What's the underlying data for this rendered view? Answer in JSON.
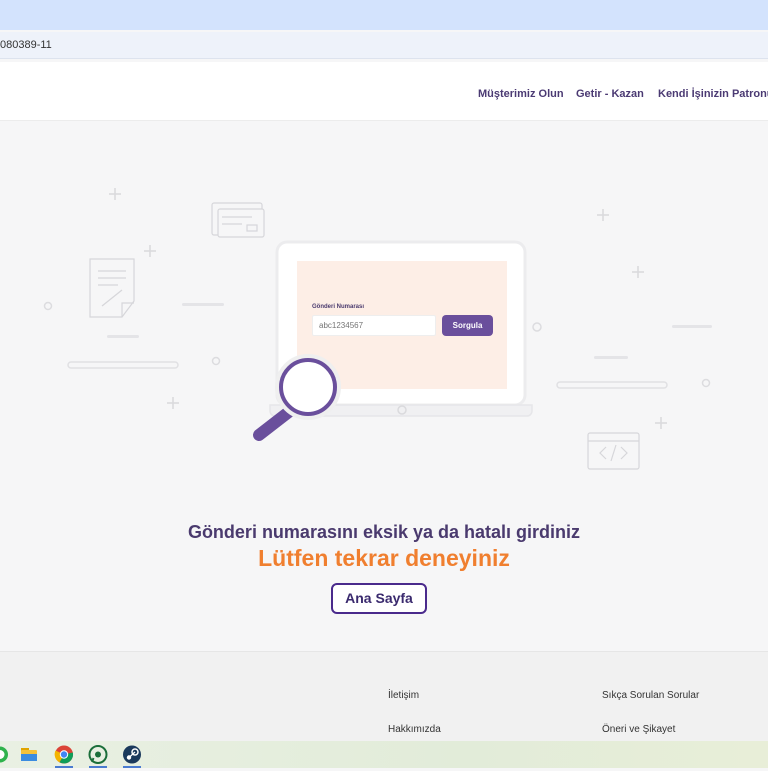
{
  "browser": {
    "url": "080389-11"
  },
  "nav": {
    "items": [
      {
        "label": "Müşterimiz Olun"
      },
      {
        "label": "Getir - Kazan"
      },
      {
        "label": "Kendi İşinizin Patronu O"
      }
    ]
  },
  "tracking": {
    "field_label": "Gönderi Numarası",
    "placeholder": "abc1234567",
    "button_label": "Sorgula"
  },
  "message": {
    "error": "Gönderi numarasını eksik ya da hatalı girdiniz",
    "retry": "Lütfen tekrar deneyiniz",
    "home_button": "Ana Sayfa"
  },
  "footer": {
    "links": [
      {
        "label": "İletişim"
      },
      {
        "label": "Sıkça Sorulan Sorular"
      },
      {
        "label": "Hakkımızda"
      },
      {
        "label": "Öneri ve Şikayet"
      }
    ]
  },
  "taskbar": {
    "apps": [
      {
        "icon": "whatsapp-icon"
      },
      {
        "icon": "file-explorer-icon"
      },
      {
        "icon": "chrome-icon"
      },
      {
        "icon": "whatsapp-icon"
      },
      {
        "icon": "steam-icon"
      }
    ]
  },
  "colors": {
    "brand_purple": "#6a4f9c",
    "accent_orange": "#f07f2f",
    "screen_peach": "#fdeee6"
  }
}
